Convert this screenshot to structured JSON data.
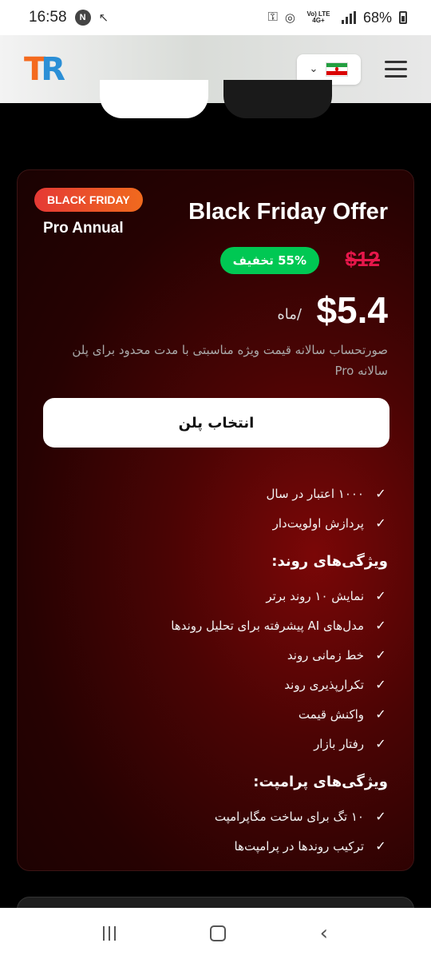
{
  "status_bar": {
    "time": "16:58",
    "badge": "N",
    "signal_labels": "Vo) LTE 4G+",
    "battery": "68%"
  },
  "header": {
    "logo_t": "T",
    "logo_r": "R",
    "language_flag": "iran-flag-icon"
  },
  "card": {
    "badge": "BLACK FRIDAY",
    "plan_name": "Pro Annual",
    "title": "Black Friday Offer",
    "old_price": "$12",
    "discount": "55% تخفیف",
    "price": "$5.4",
    "per": "/ماه",
    "description": "صورتحساب سالانه قیمت ویژه مناسبتی با مدت محدود برای پلن سالانه Pro",
    "cta": "انتخاب پلن",
    "features_basic": [
      "۱۰۰۰ اعتبار در سال",
      "پردازش اولویت‌دار"
    ],
    "trend_title": "ویژگی‌های روند:",
    "features_trend": [
      "نمایش ۱۰ روند برتر",
      "مدل‌های AI پیشرفته برای تحلیل روندها",
      "خط زمانی روند",
      "تکرارپذیری روند",
      "واکنش قیمت",
      "رفتار بازار"
    ],
    "prompt_title": "ویژگی‌های پرامپت:",
    "features_prompt": [
      "۱۰ تگ برای ساخت مگاپرامپت",
      "ترکیب روندها در پرامپت‌ها"
    ]
  },
  "colors": {
    "accent_orange": "#f46a1e",
    "accent_blue": "#2b8fd6",
    "discount_green": "#00c853",
    "strike_red": "#e6174b"
  }
}
